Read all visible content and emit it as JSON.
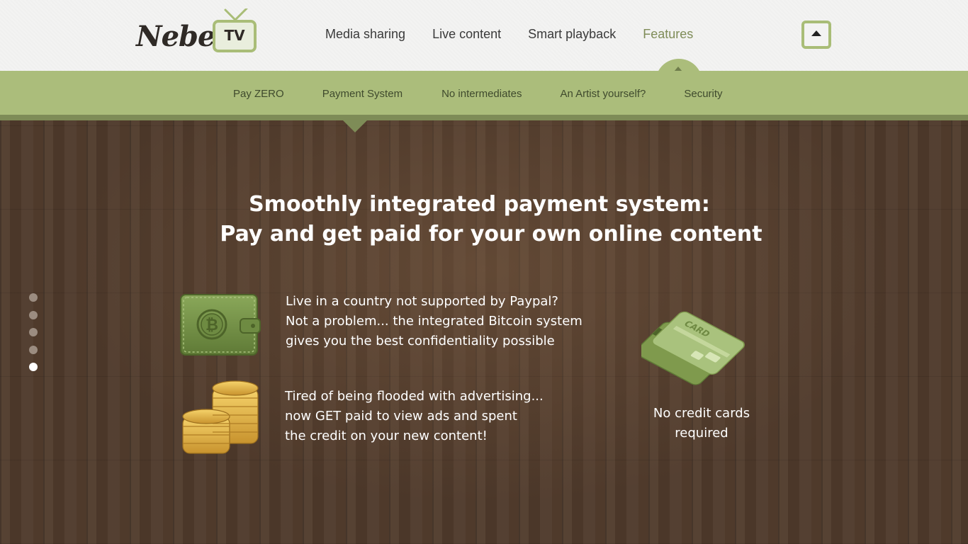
{
  "brand": {
    "logo_text": "Nebel.",
    "logo_tv": "TV"
  },
  "main_nav": {
    "items": [
      {
        "label": "Media sharing"
      },
      {
        "label": "Live content"
      },
      {
        "label": "Smart playback"
      },
      {
        "label": "Features",
        "active": true
      }
    ]
  },
  "scroll_top": {
    "icon": "arrow-up-icon"
  },
  "sub_nav": {
    "items": [
      {
        "label": "Pay ZERO"
      },
      {
        "label": "Payment System",
        "active": true
      },
      {
        "label": "No intermediates"
      },
      {
        "label": "An Artist yourself?"
      },
      {
        "label": "Security"
      }
    ]
  },
  "hero": {
    "title_line1": "Smoothly integrated payment system:",
    "title_line2": "Pay and get paid for your own online content"
  },
  "slider": {
    "count": 5,
    "active_index": 4
  },
  "features": [
    {
      "icon": "wallet-icon",
      "lines": [
        "Live in a country not supported by Paypal?",
        "Not a problem... the integrated Bitcoin system",
        "gives you the best confidentiality possible"
      ]
    },
    {
      "icon": "coins-icon",
      "lines": [
        "Tired of being flooded with advertising...",
        "now GET paid to view ads and spent",
        "the credit on your new content!"
      ]
    }
  ],
  "credit_card": {
    "icon": "credit-card-icon",
    "card_text": "CARD",
    "caption_line1": "No credit cards",
    "caption_line2": "required"
  },
  "colors": {
    "accent_green": "#abbd7b",
    "accent_dark_green": "#7e8c57",
    "active_nav": "#7f8c58",
    "wood": "#4f3a2b"
  }
}
